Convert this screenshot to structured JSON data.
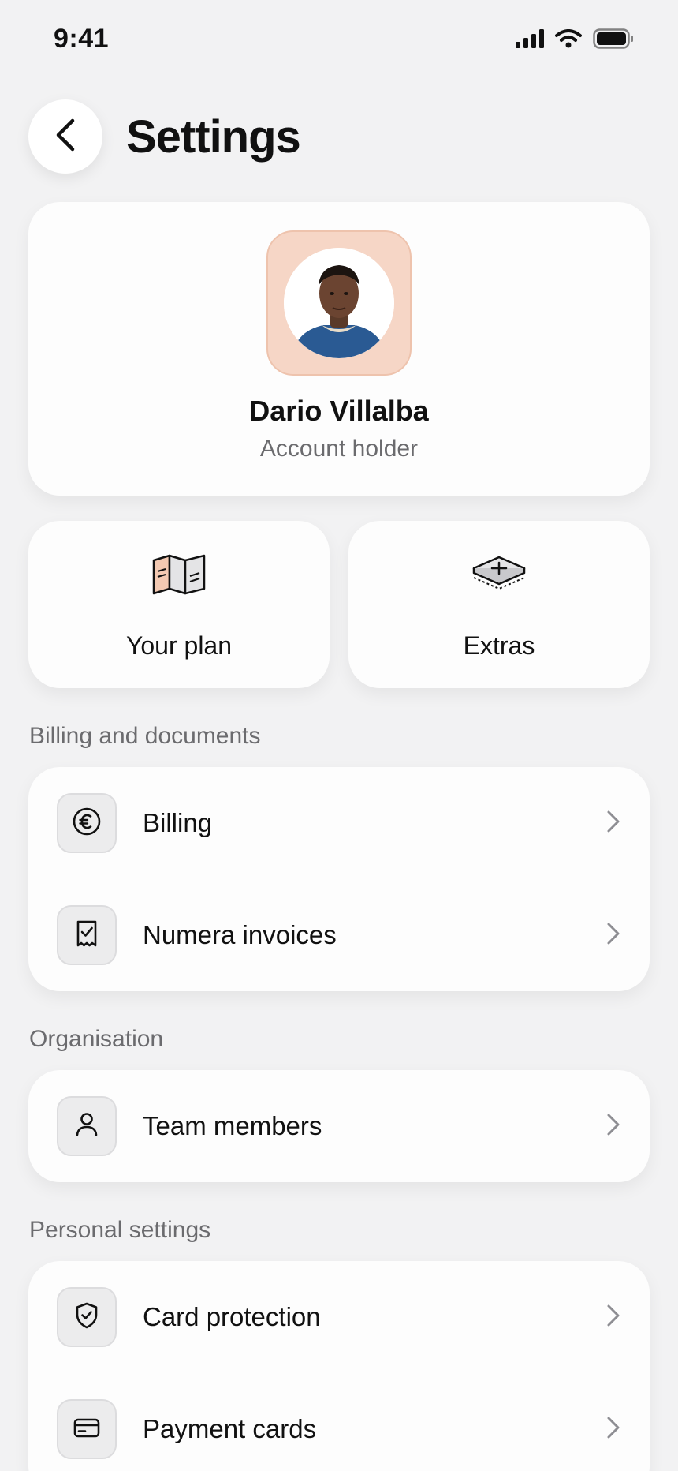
{
  "status_bar": {
    "time": "9:41",
    "icons": [
      "signal-icon",
      "wifi-icon",
      "battery-icon"
    ]
  },
  "header": {
    "title": "Settings",
    "back_icon": "chevron-left-icon"
  },
  "profile": {
    "name": "Dario Villalba",
    "role": "Account holder",
    "avatar_frame_color": "#f6d6c6"
  },
  "tiles": [
    {
      "label": "Your plan",
      "icon": "plan-map-icon"
    },
    {
      "label": "Extras",
      "icon": "extras-box-icon"
    }
  ],
  "sections": [
    {
      "title": "Billing and documents",
      "items": [
        {
          "label": "Billing",
          "icon": "euro-icon"
        },
        {
          "label": "Numera invoices",
          "icon": "receipt-check-icon"
        }
      ]
    },
    {
      "title": "Organisation",
      "items": [
        {
          "label": "Team members",
          "icon": "person-icon"
        }
      ]
    },
    {
      "title": "Personal settings",
      "items": [
        {
          "label": "Card protection",
          "icon": "shield-check-icon"
        },
        {
          "label": "Payment cards",
          "icon": "credit-card-icon"
        }
      ]
    }
  ],
  "colors": {
    "background": "#f2f2f3",
    "card": "#fdfdfd",
    "text_primary": "#111111",
    "text_secondary": "#6b6b6e",
    "chevron": "#8e8e93"
  }
}
